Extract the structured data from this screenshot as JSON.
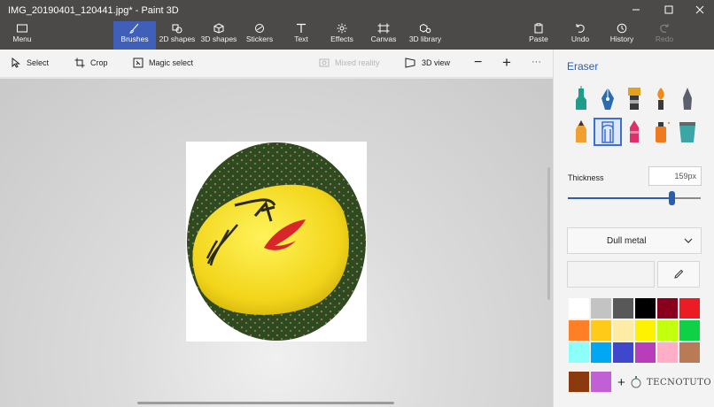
{
  "window": {
    "title": "IMG_20190401_120441.jpg* - Paint 3D",
    "controls": {
      "minimize": "minimize-icon",
      "maximize": "maximize-icon",
      "close": "close-icon"
    }
  },
  "ribbon": {
    "menu_label": "Menu",
    "tools": [
      {
        "label": "Brushes",
        "icon": "brush-icon",
        "active": true
      },
      {
        "label": "2D shapes",
        "icon": "2d-shapes-icon"
      },
      {
        "label": "3D shapes",
        "icon": "3d-shapes-icon"
      },
      {
        "label": "Stickers",
        "icon": "stickers-icon"
      },
      {
        "label": "Text",
        "icon": "text-icon"
      },
      {
        "label": "Effects",
        "icon": "effects-icon"
      },
      {
        "label": "Canvas",
        "icon": "canvas-icon"
      },
      {
        "label": "3D library",
        "icon": "3d-library-icon"
      }
    ],
    "paste_label": "Paste",
    "undo_label": "Undo",
    "history_label": "History",
    "redo_label": "Redo",
    "accent_color": "#3f5fb8"
  },
  "subtoolbar": {
    "select_label": "Select",
    "crop_label": "Crop",
    "magic_select_label": "Magic select",
    "mixed_reality_label": "Mixed reality",
    "view_3d_label": "3D view",
    "zoom_out": "−",
    "zoom_in": "+",
    "more": "···"
  },
  "canvas": {
    "image_subject": "yellow emoji pillow on green patterned fabric, cropped to an ellipse"
  },
  "panel": {
    "title": "Eraser",
    "brushes": [
      {
        "name": "marker-brush-icon",
        "color": "#1e9e8a"
      },
      {
        "name": "calligraphy-pen-brush-icon",
        "color": "#2b6cb0"
      },
      {
        "name": "oil-brush-icon",
        "color": "#e5a020"
      },
      {
        "name": "watercolor-brush-icon",
        "color": "#f08a1c"
      },
      {
        "name": "pixel-pen-brush-icon",
        "color": "#5a5f6b"
      },
      {
        "name": "pencil-brush-icon",
        "color": "#f0a030"
      },
      {
        "name": "eraser-brush-icon",
        "color": "#3a6fd8",
        "selected": true
      },
      {
        "name": "crayon-brush-icon",
        "color": "#e0306a"
      },
      {
        "name": "spray-can-brush-icon",
        "color": "#f07a20"
      },
      {
        "name": "fill-bucket-icon",
        "color": "#3aa6a6"
      }
    ],
    "thickness_label": "Thickness",
    "thickness_value": "159px",
    "thickness_fraction": 0.78,
    "texture_label": "Dull metal",
    "eyedropper": "eyedropper-icon",
    "palette": [
      "#ffffff",
      "#c3c3c3",
      "#585858",
      "#000000",
      "#88001b",
      "#ec1c24",
      "#ff7f27",
      "#ffca18",
      "#fdeca6",
      "#fff200",
      "#c4ff0e",
      "#0ed145",
      "#8cfffb",
      "#00a8f3",
      "#3f48cc",
      "#b83dba",
      "#ffaec8",
      "#b97a56"
    ],
    "custom_colors": [
      "#8b3a0e",
      "#c25fd4"
    ],
    "add_color_label": "+",
    "watermark_text": "TECNOTUTO"
  }
}
